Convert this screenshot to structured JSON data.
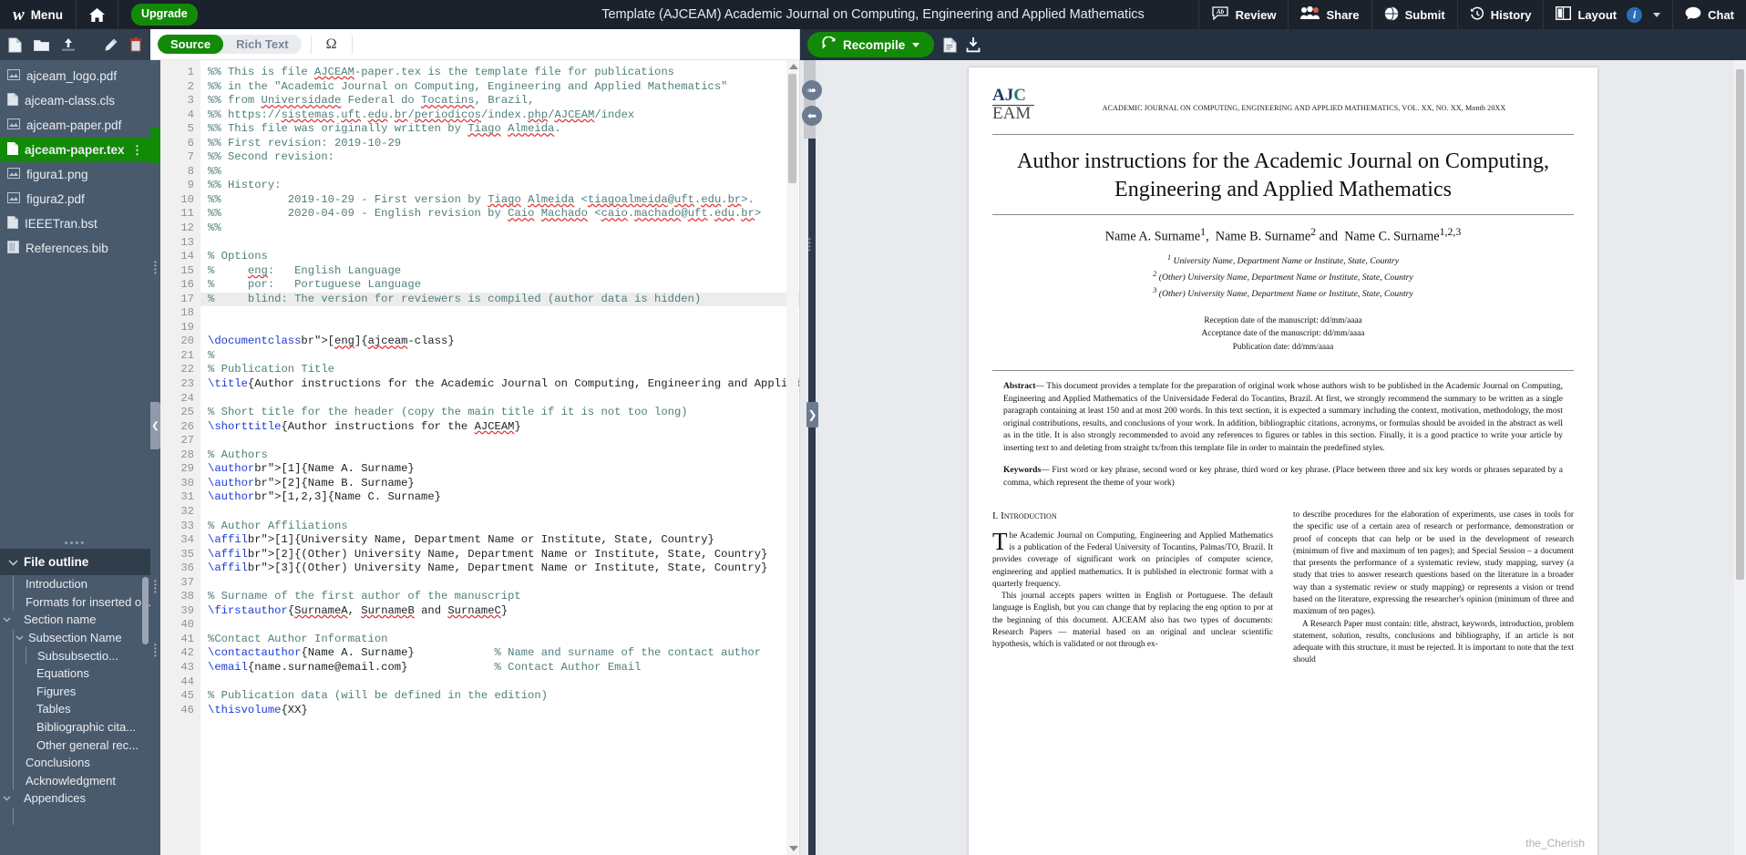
{
  "topnav": {
    "menu_label": "Menu",
    "home_icon": "home-icon",
    "upgrade_label": "Upgrade",
    "project_title": "Template (AJCEAM) Academic Journal on Computing, Engineering and Applied Mathematics",
    "actions": [
      {
        "label": "Review",
        "icon": "review-icon"
      },
      {
        "label": "Share",
        "icon": "share-people-icon"
      },
      {
        "label": "Submit",
        "icon": "submit-globe-icon"
      },
      {
        "label": "History",
        "icon": "history-clock-icon"
      },
      {
        "label": "Layout",
        "icon": "layout-columns-icon",
        "badge": "i"
      },
      {
        "label": "Chat",
        "icon": "chat-bubble-icon"
      }
    ]
  },
  "sidebar": {
    "toolbar_icons": [
      "new-file-icon",
      "new-folder-icon",
      "upload-icon",
      "rename-pencil-icon",
      "delete-trash-icon"
    ],
    "files": [
      {
        "name": "ajceam_logo.pdf",
        "icon": "image-file-icon",
        "selected": false
      },
      {
        "name": "ajceam-class.cls",
        "icon": "text-file-icon",
        "selected": false
      },
      {
        "name": "ajceam-paper.pdf",
        "icon": "image-file-icon",
        "selected": false
      },
      {
        "name": "ajceam-paper.tex",
        "icon": "text-file-icon",
        "selected": true
      },
      {
        "name": "figura1.png",
        "icon": "image-file-icon",
        "selected": false
      },
      {
        "name": "figura2.pdf",
        "icon": "image-file-icon",
        "selected": false
      },
      {
        "name": "IEEETran.bst",
        "icon": "text-file-icon",
        "selected": false
      },
      {
        "name": "References.bib",
        "icon": "bib-file-icon",
        "selected": false
      }
    ],
    "outline_title": "File outline",
    "outline": [
      {
        "label": "Introduction",
        "depth": 1,
        "expandable": false
      },
      {
        "label": "Formats for inserted o...",
        "depth": 1,
        "expandable": false
      },
      {
        "label": "Section name",
        "depth": 1,
        "expandable": true
      },
      {
        "label": "Subsection Name",
        "depth": 2,
        "expandable": true
      },
      {
        "label": "Subsubsectio...",
        "depth": 3,
        "expandable": false
      },
      {
        "label": "Equations",
        "depth": 2,
        "expandable": false
      },
      {
        "label": "Figures",
        "depth": 2,
        "expandable": false
      },
      {
        "label": "Tables",
        "depth": 2,
        "expandable": false
      },
      {
        "label": "Bibliographic cita...",
        "depth": 2,
        "expandable": false
      },
      {
        "label": "Other general rec...",
        "depth": 2,
        "expandable": false
      },
      {
        "label": "Conclusions",
        "depth": 1,
        "expandable": false
      },
      {
        "label": "Acknowledgment",
        "depth": 1,
        "expandable": false
      },
      {
        "label": "Appendices",
        "depth": 1,
        "expandable": true
      }
    ]
  },
  "editor": {
    "mode_source": "Source",
    "mode_richtext": "Rich Text",
    "mode_active": "Source",
    "symbol_palette_icon": "omega-symbol-icon",
    "highlighted_line": 17,
    "first_line_number": 1,
    "lines": [
      "%% This is file AJCEAM-paper.tex is the template file for publications",
      "%% in the \"Academic Journal on Computing, Engineering and Applied Mathematics\"",
      "%% from Universidade Federal do Tocatins, Brazil,",
      "%% https://sistemas.uft.edu.br/periodicos/index.php/AJCEAM/index",
      "%% This file was originally written by Tiago Almeida.",
      "%% First revision: 2019-10-29",
      "%% Second revision:",
      "%%",
      "%% History:",
      "%%          2019-10-29 - First version by Tiago Almeida <tiagoalmeida@uft.edu.br>.",
      "%%          2020-04-09 - English revision by Caio Machado <caio.machado@uft.edu.br>",
      "%%",
      "",
      "% Options",
      "%     eng:   English Language",
      "%     por:   Portuguese Language",
      "%     blind: The version for reviewers is compiled (author data is hidden)",
      "",
      "",
      "\\documentclass[eng]{ajceam-class}",
      "%",
      "% Publication Title",
      "\\title{Author instructions for the Academic Journal on Computing, Engineering and Applied Mathematics}",
      "",
      "% Short title for the header (copy the main title if it is not too long)",
      "\\shorttitle{Author instructions for the AJCEAM}",
      "",
      "% Authors",
      "\\author[1]{Name A. Surname}",
      "\\author[2]{Name B. Surname}",
      "\\author[1,2,3]{Name C. Surname}",
      "",
      "% Author Affiliations",
      "\\affil[1]{University Name, Department Name or Institute, State, Country}",
      "\\affil[2]{(Other) University Name, Department Name or Institute, State, Country}",
      "\\affil[3]{(Other) University Name, Department Name or Institute, State, Country}",
      "",
      "% Surname of the first author of the manuscript",
      "\\firstauthor{SurnameA, SurnameB and SurnameC}",
      "",
      "%Contact Author Information",
      "\\contactauthor{Name A. Surname}            % Name and surname of the contact author",
      "\\email{name.surname@email.com}             % Contact Author Email",
      "",
      "% Publication data (will be defined in the edition)",
      "\\thisvolume{XX}"
    ]
  },
  "pdf": {
    "recompile_label": "Recompile",
    "recompile_icon": "refresh-icon",
    "toolbar_icons": [
      "logs-file-icon",
      "download-pdf-icon"
    ],
    "logo_top": "AJC",
    "logo_bottom": "EAM",
    "journal_header": "ACADEMIC JOURNAL ON COMPUTING, ENGINEERING AND APPLIED MATHEMATICS, VOL. XX, NO. XX, Month 20XX",
    "title": "Author instructions for the Academic Journal on Computing, Engineering and Applied Mathematics",
    "authors": "Name A. Surname1, Name B. Surname2 and Name C. Surname1,2,3",
    "affiliations": [
      "1 University Name, Department Name or Institute, State, Country",
      "2 (Other) University Name, Department Name or Institute, State, Country",
      "3 (Other) University Name, Department Name or Institute, State, Country"
    ],
    "dates": [
      "Reception date of the manuscript: dd/mm/aaaa",
      "Acceptance date of the manuscript: dd/mm/aaaa",
      "Publication date: dd/mm/aaaa"
    ],
    "abstract_label": "Abstract",
    "abstract_text": "— This document provides a template for the preparation of original work whose authors wish to be published in the Academic Journal on Computing, Engineering and Applied Mathematics of the Universidade Federal do Tocantins, Brazil. At first, we strongly recommend the summary to be written as a single paragraph containing at least 150 and at most 200 words. In this text section, it is expected a summary including the context, motivation, methodology, the most original contributions, results, and conclusions of your work. In addition, bibliographic citations, acronyms, or formulas should be avoided in the abstract as well as in the title. It is also strongly recommended to avoid any references to figures or tables in this section. Finally, it is a good practice to write your article by inserting text to and deleting from straight tx/from this template file in order to maintain the predefined styles.",
    "keywords_label": "Keywords",
    "keywords_text": "— First word or key phrase, second word or key phrase, third word or key phrase. (Place between three and six key words or phrases separated by a comma, which represent the theme of your work)",
    "section_heading": "I. Introduction",
    "col1_dropcap": "T",
    "col1_p1": "he Academic Journal on Computing, Engineering and Applied Mathematics is a publication of the Federal University of Tocantins, Palmas/TO, Brazil. It provides coverage of significant work on principles of computer science, engineering and applied mathematics. It is published in electronic format with a quarterly frequency.",
    "col1_p2": "This journal accepts papers written in English or Portuguese. The default language is English, but you can change that by replacing the eng option to por at the beginning of this document. AJCEAM also has two types of documents: Research Papers — material based on an original and unclear scientific hypothesis, which is validated or not through ex-",
    "col2_p1": "to describe procedures for the elaboration of experiments, use cases in tools for the specific use of a certain area of research or performance, demonstration or proof of concepts that can help or be used in the development of research (minimum of five and maximum of ten pages); and Special Session – a document that presents the performance of a systematic review, study mapping, survey (a study that tries to answer research questions based on the literature in a broader way than a systematic review or study mapping) or represents a vision or trend based on the literature, expressing the researcher's opinion (minimum of three and maximum of ten pages).",
    "col2_p2": "A Research Paper must contain: title, abstract, keywords, introduction, problem statement, solution, results, conclusions and bibliography, if an article is not adequate with this structure, it must be rejected. It is important to note that the text should",
    "watermark": "the_Cherish"
  }
}
